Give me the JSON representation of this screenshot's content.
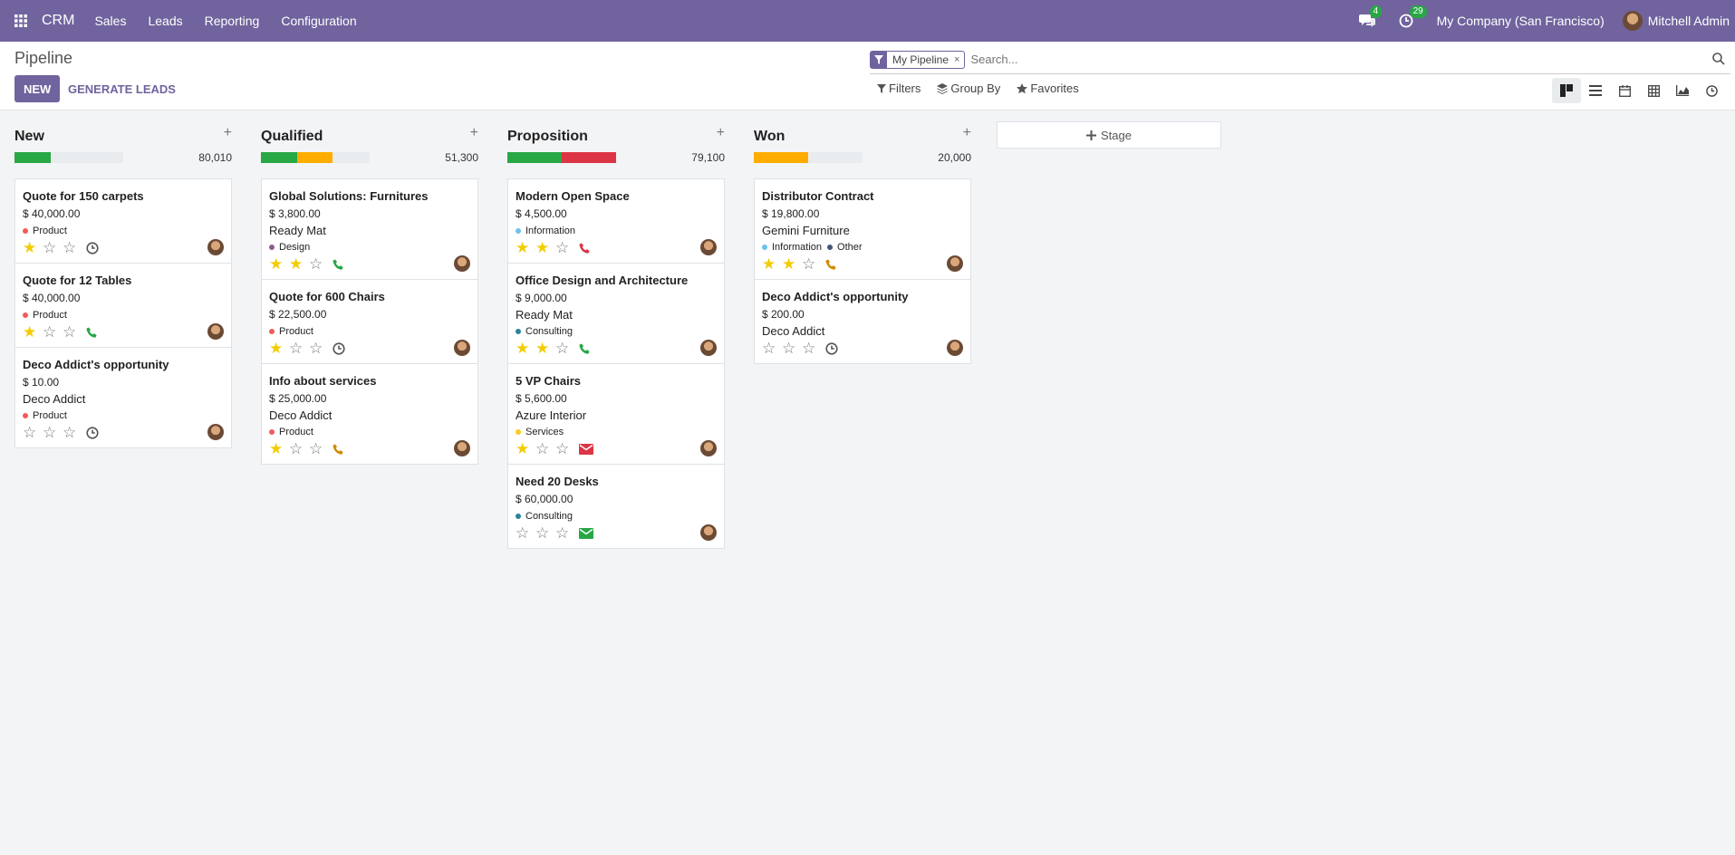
{
  "navbar": {
    "brand": "CRM",
    "menus": [
      "Sales",
      "Leads",
      "Reporting",
      "Configuration"
    ],
    "messages_count": "4",
    "activities_count": "29",
    "company": "My Company (San Francisco)",
    "user": "Mitchell Admin"
  },
  "control": {
    "title": "Pipeline",
    "new_label": "NEW",
    "generate_label": "GENERATE LEADS",
    "facet_label": "My Pipeline",
    "facet_close": "×",
    "search_placeholder": "Search...",
    "filters_label": "Filters",
    "groupby_label": "Group By",
    "favorites_label": "Favorites"
  },
  "kanban": {
    "add_stage_label": "Stage",
    "columns": [
      {
        "title": "New",
        "total": "80,010",
        "progress": [
          {
            "color": "#28a745",
            "fraction": 0.33
          }
        ],
        "cards": [
          {
            "title": "Quote for 150 carpets",
            "amount": "$ 40,000.00",
            "partner": "",
            "tags": [
              {
                "label": "Product",
                "color": "#f25b5b"
              }
            ],
            "stars": 1,
            "activity": "clock",
            "activity_color": "#555555"
          },
          {
            "title": "Quote for 12 Tables",
            "amount": "$ 40,000.00",
            "partner": "",
            "tags": [
              {
                "label": "Product",
                "color": "#f25b5b"
              }
            ],
            "stars": 1,
            "activity": "phone",
            "activity_color": "#28a745"
          },
          {
            "title": "Deco Addict's opportunity",
            "amount": "$ 10.00",
            "partner": "Deco Addict",
            "tags": [
              {
                "label": "Product",
                "color": "#f25b5b"
              }
            ],
            "stars": 0,
            "activity": "clock",
            "activity_color": "#555555"
          }
        ]
      },
      {
        "title": "Qualified",
        "total": "51,300",
        "progress": [
          {
            "color": "#28a745",
            "fraction": 0.33
          },
          {
            "color": "#ffac00",
            "fraction": 0.33
          }
        ],
        "cards": [
          {
            "title": "Global Solutions: Furnitures",
            "amount": "$ 3,800.00",
            "partner": "Ready Mat",
            "tags": [
              {
                "label": "Design",
                "color": "#8e5b8e"
              }
            ],
            "stars": 2,
            "activity": "phone",
            "activity_color": "#28a745"
          },
          {
            "title": "Quote for 600 Chairs",
            "amount": "$ 22,500.00",
            "partner": "",
            "tags": [
              {
                "label": "Product",
                "color": "#f25b5b"
              }
            ],
            "stars": 1,
            "activity": "clock",
            "activity_color": "#555555"
          },
          {
            "title": "Info about services",
            "amount": "$ 25,000.00",
            "partner": "Deco Addict",
            "tags": [
              {
                "label": "Product",
                "color": "#f25b5b"
              }
            ],
            "stars": 1,
            "activity": "phone",
            "activity_color": "#d08a00"
          }
        ]
      },
      {
        "title": "Proposition",
        "total": "79,100",
        "progress": [
          {
            "color": "#28a745",
            "fraction": 0.5
          },
          {
            "color": "#dc3545",
            "fraction": 0.5
          }
        ],
        "cards": [
          {
            "title": "Modern Open Space",
            "amount": "$ 4,500.00",
            "partner": "",
            "tags": [
              {
                "label": "Information",
                "color": "#6cc1ed"
              }
            ],
            "stars": 2,
            "activity": "phone",
            "activity_color": "#dc3545"
          },
          {
            "title": "Office Design and Architecture",
            "amount": "$ 9,000.00",
            "partner": "Ready Mat",
            "tags": [
              {
                "label": "Consulting",
                "color": "#2c8397"
              }
            ],
            "stars": 2,
            "activity": "phone",
            "activity_color": "#28a745"
          },
          {
            "title": "5 VP Chairs",
            "amount": "$ 5,600.00",
            "partner": "Azure Interior",
            "tags": [
              {
                "label": "Services",
                "color": "#f7cd1f"
              }
            ],
            "stars": 1,
            "activity": "mail",
            "activity_color": "#dc3545"
          },
          {
            "title": "Need 20 Desks",
            "amount": "$ 60,000.00",
            "partner": "",
            "tags": [
              {
                "label": "Consulting",
                "color": "#2c8397"
              }
            ],
            "stars": 0,
            "activity": "mail",
            "activity_color": "#28a745"
          }
        ]
      },
      {
        "title": "Won",
        "total": "20,000",
        "progress": [
          {
            "color": "#ffac00",
            "fraction": 0.5
          }
        ],
        "cards": [
          {
            "title": "Distributor Contract",
            "amount": "$ 19,800.00",
            "partner": "Gemini Furniture",
            "tags": [
              {
                "label": "Information",
                "color": "#6cc1ed"
              },
              {
                "label": "Other",
                "color": "#475577"
              }
            ],
            "stars": 2,
            "activity": "phone",
            "activity_color": "#d08a00"
          },
          {
            "title": "Deco Addict's opportunity",
            "amount": "$ 200.00",
            "partner": "Deco Addict",
            "tags": [],
            "stars": 0,
            "activity": "clock",
            "activity_color": "#555555"
          }
        ]
      }
    ]
  }
}
